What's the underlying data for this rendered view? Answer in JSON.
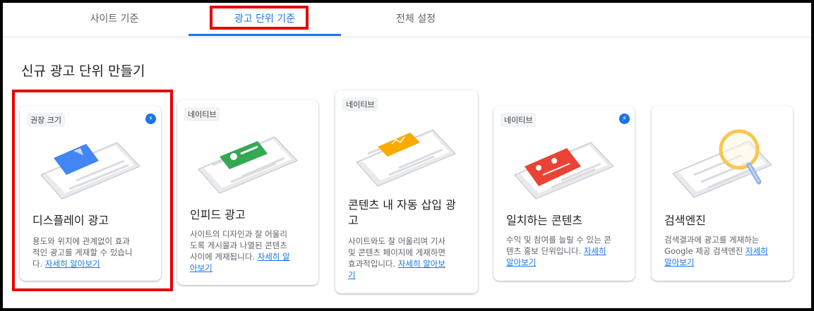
{
  "tabs": [
    {
      "label": "사이트 기준"
    },
    {
      "label": "광고 단위 기준"
    },
    {
      "label": "전체 설정"
    }
  ],
  "section_title": "신규 광고 단위 만들기",
  "cards": [
    {
      "badge": "권장 크기",
      "title": "디스플레이 광고",
      "desc": "용도와 위치에 관계없이 효과\n적인 광고를 게재할 수 있습니\n다.",
      "link": "자세히 알아보기",
      "accent": "#4285f4",
      "bolt": true
    },
    {
      "badge": "네이티브",
      "title": "인피드 광고",
      "desc": "사이트의 디자인과 잘 어울리\n도록 게시물과 나열된 콘텐츠\n사이에 게재됩니다.",
      "link": "자세히 알\n아보기",
      "accent": "#34a853",
      "bolt": false
    },
    {
      "badge": "네이티브",
      "title": "콘텐츠 내 자동 삽입 광\n고",
      "desc": "사이트와도 잘 어울리며 기사\n및 콘텐츠 페이지에 게재하면\n효과적입니다.",
      "link": "자세히 알아보\n기",
      "accent": "#f9ab00",
      "bolt": false
    },
    {
      "badge": "네이티브",
      "title": "일치하는 콘텐츠",
      "desc": "수익 및 참여를 늘릴 수 있는 콘\n텐츠 홍보 단위입니다.",
      "link": "자세히\n알아보기",
      "accent": "#ea4335",
      "bolt": true
    },
    {
      "badge": "",
      "title": "검색엔진",
      "desc": "검색결과에 광고를 게재하는\nGoogle 제공 검색엔진",
      "link": "자세히\n알아보기",
      "accent": "#fbbc04",
      "bolt": false
    }
  ],
  "icons": {
    "bolt": "lightning-bolt-icon"
  }
}
